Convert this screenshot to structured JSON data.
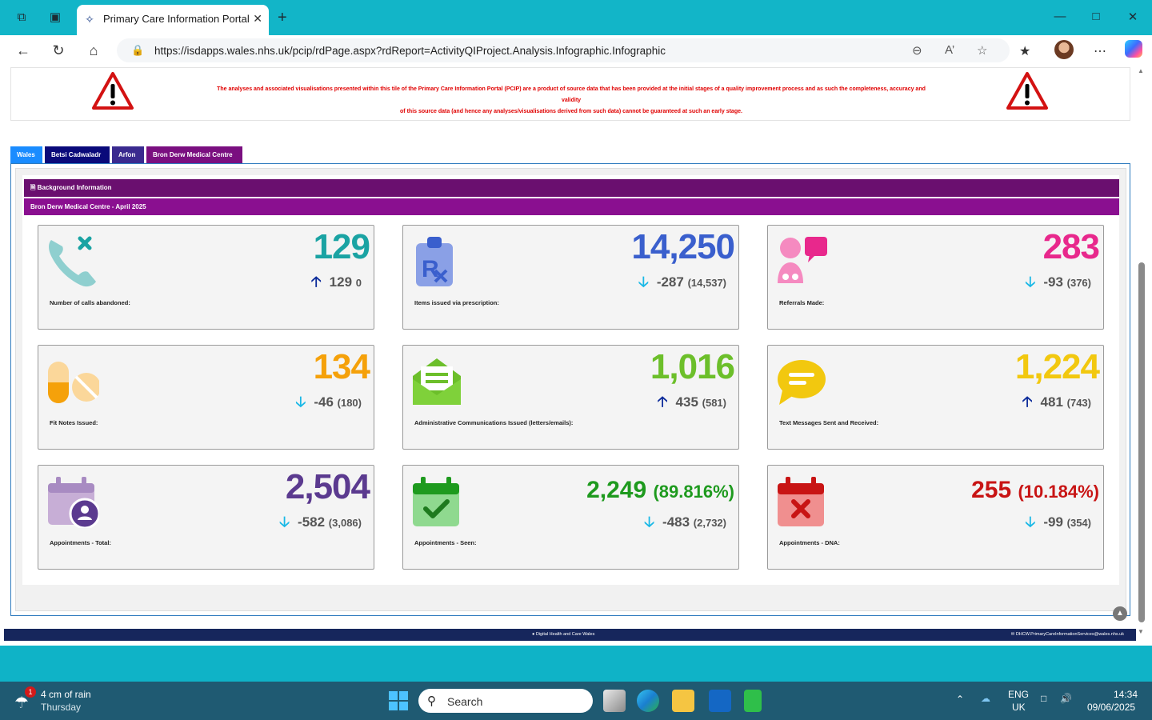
{
  "browser": {
    "tab_title": "Primary Care Information Portal",
    "url": "https://isdapps.wales.nhs.uk/pcip/rdPage.aspx?rdReport=ActivityQIProject.Analysis.Infographic.Infographic"
  },
  "banner": {
    "line1": "The analyses and associated visualisations presented within this tile of the Primary Care Information Portal (PCIP) are a product of source data that has been provided at the initial stages of a quality improvement process and as such the completeness, accuracy and validity",
    "line2": "of this source data (and hence any analyses/visualisations derived from such data) cannot be guaranteed at such an early stage."
  },
  "level_tabs": [
    {
      "label": "Wales",
      "color": "#1a8cff"
    },
    {
      "label": "Betsi Cadwaladr",
      "color": "#0a0a7a"
    },
    {
      "label": "Arfon",
      "color": "#3a2a8f"
    },
    {
      "label": "Bron Derw Medical Centre",
      "color": "#7a0f80"
    }
  ],
  "section": {
    "header": "Background Information",
    "subheader": "Bron Derw Medical Centre - April 2025"
  },
  "cards": [
    {
      "label": "Number of calls abandoned:",
      "value": "129",
      "delta": "129",
      "prev": "0",
      "direction": "up",
      "color": "#1aa3a3",
      "arrow_color": "#0a2a9a",
      "icon": "phone-x-icon"
    },
    {
      "label": "Items issued via prescription:",
      "value": "14,250",
      "delta": "-287",
      "prev": "(14,537)",
      "direction": "down",
      "color": "#3a5fcd",
      "arrow_color": "#19b8e6",
      "icon": "prescription-icon"
    },
    {
      "label": "Referrals Made:",
      "value": "283",
      "delta": "-93",
      "prev": "(376)",
      "direction": "down",
      "color": "#e8288c",
      "arrow_color": "#19b8e6",
      "icon": "doctor-chat-icon"
    },
    {
      "label": "Fit Notes Issued:",
      "value": "134",
      "delta": "-46",
      "prev": "(180)",
      "direction": "down",
      "color": "#f5a10a",
      "arrow_color": "#19b8e6",
      "icon": "pills-icon"
    },
    {
      "label": "Administrative Communications Issued (letters/emails):",
      "value": "1,016",
      "delta": "435",
      "prev": "(581)",
      "direction": "up",
      "color": "#6cbf2a",
      "arrow_color": "#0a2a9a",
      "icon": "envelope-icon"
    },
    {
      "label": "Text Messages Sent and Received:",
      "value": "1,224",
      "delta": "481",
      "prev": "(743)",
      "direction": "up",
      "color": "#f2c80f",
      "arrow_color": "#0a2a9a",
      "icon": "chat-bubble-icon"
    },
    {
      "label": "Appointments - Total:",
      "value": "2,504",
      "pct": "",
      "delta": "-582",
      "prev": "(3,086)",
      "direction": "down",
      "color": "#5b3a8f",
      "arrow_color": "#19b8e6",
      "icon": "calendar-user-icon"
    },
    {
      "label": "Appointments - Seen:",
      "value": "2,249",
      "pct": "(89.816%)",
      "delta": "-483",
      "prev": "(2,732)",
      "direction": "down",
      "color": "#1e9a1e",
      "arrow_color": "#19b8e6",
      "icon": "calendar-check-icon"
    },
    {
      "label": "Appointments - DNA:",
      "value": "255",
      "pct": "(10.184%)",
      "delta": "-99",
      "prev": "(354)",
      "direction": "down",
      "color": "#c81414",
      "arrow_color": "#19b8e6",
      "icon": "calendar-x-icon"
    }
  ],
  "footer": {
    "left": "Digital Health and Care Wales",
    "right": "DHCW.PrimaryCareInformationServices@wales.nhs.uk"
  },
  "taskbar": {
    "weather_temp": "4 cm of rain",
    "weather_day": "Thursday",
    "weather_badge": "1",
    "search_placeholder": "Search",
    "lang1": "ENG",
    "lang2": "UK",
    "time": "14:34",
    "date": "09/06/2025"
  }
}
